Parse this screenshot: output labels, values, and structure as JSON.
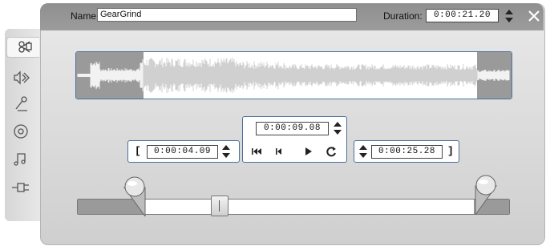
{
  "header": {
    "name_label": "Name:",
    "name_value": "GearGrind",
    "duration_label": "Duration:",
    "duration_value": "0:00:21.20"
  },
  "sidebar": {
    "items": [
      {
        "icon": "video-edit-icon",
        "selected": true
      },
      {
        "icon": "audio-volume-icon",
        "selected": false
      },
      {
        "icon": "voiceover-mic-icon",
        "selected": false
      },
      {
        "icon": "cd-disc-icon",
        "selected": false
      },
      {
        "icon": "music-note-icon",
        "selected": false
      },
      {
        "icon": "audio-plug-icon",
        "selected": false
      }
    ]
  },
  "trim": {
    "in_point": "0:00:04.09",
    "current_position": "0:00:09.08",
    "out_point": "0:00:25.28",
    "in_bracket": "[",
    "out_bracket": "]"
  },
  "colors": {
    "panel_bg": "#dcdcdc",
    "accent_border": "#4d6f9c",
    "trim_shade": "#9a9a9a"
  }
}
